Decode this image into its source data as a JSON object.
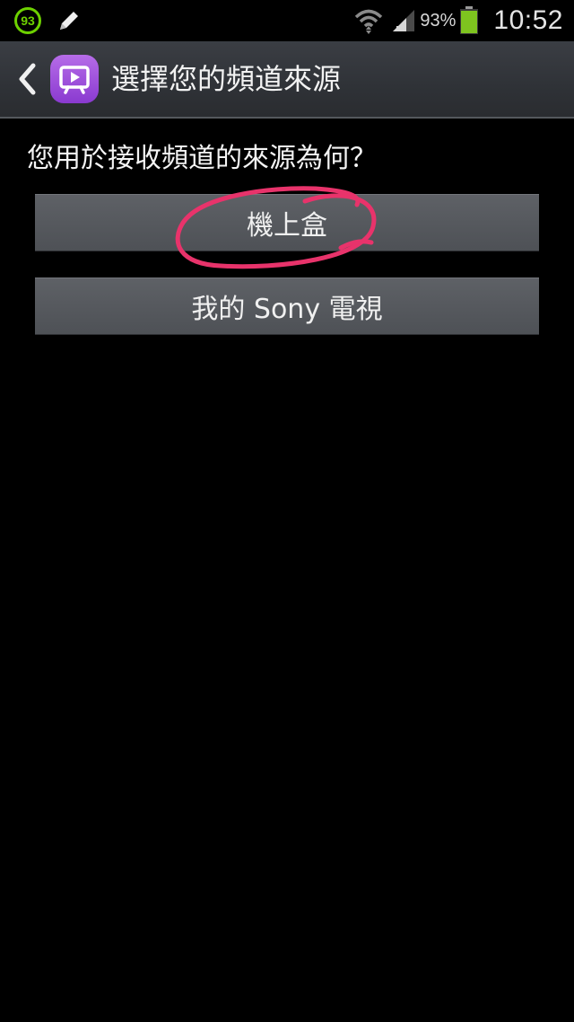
{
  "status_bar": {
    "notification_count": "93",
    "battery_percent": "93%",
    "time": "10:52",
    "icons": [
      "notification-badge-icon",
      "pencil-icon",
      "wifi-icon",
      "signal-icon",
      "battery-icon"
    ]
  },
  "action_bar": {
    "title": "選擇您的頻道來源",
    "back_icon": "chevron-left-icon",
    "app_icon": "tv-app-icon"
  },
  "content": {
    "question": "您用於接收頻道的來源為何？",
    "options": [
      {
        "label": "機上盒"
      },
      {
        "label": "我的 Sony 電視"
      }
    ]
  },
  "colors": {
    "badge_green": "#6dd100",
    "app_icon_purple": "#9b4ee0",
    "annotation_pink": "#e8336b",
    "battery_green": "#7ec41f"
  }
}
